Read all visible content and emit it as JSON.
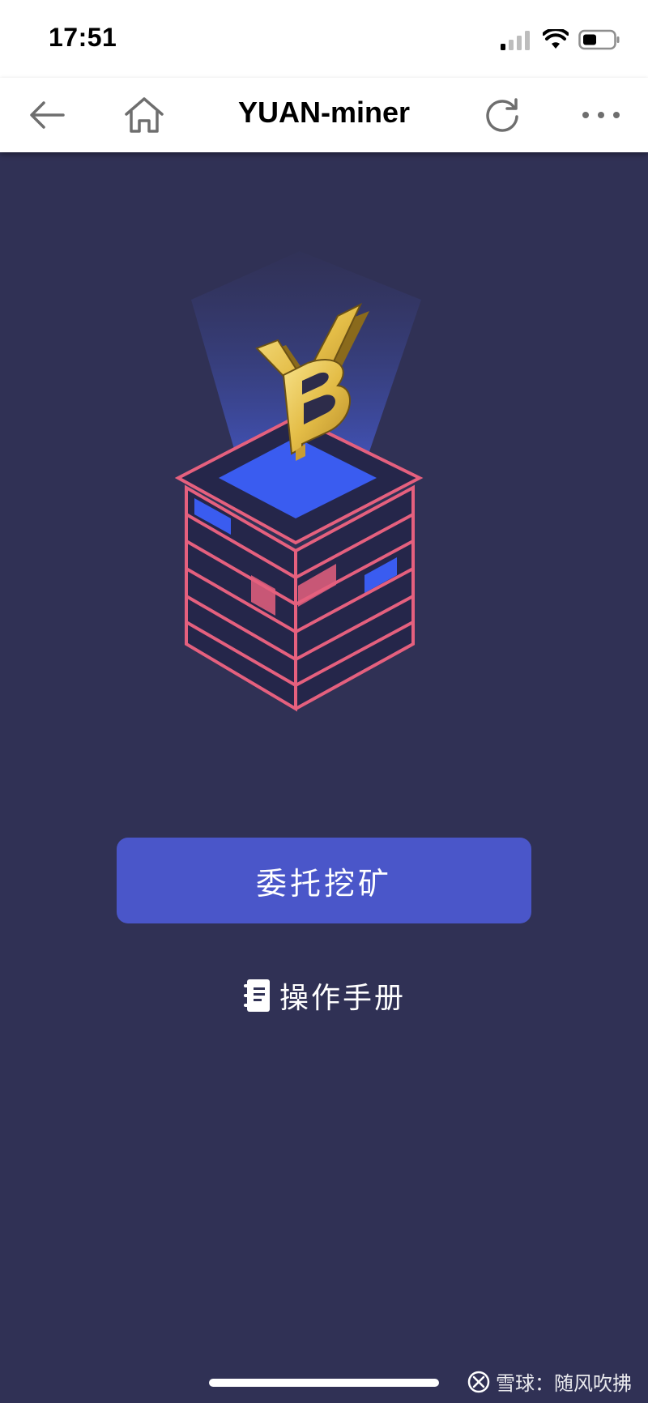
{
  "status_bar": {
    "time": "17:51"
  },
  "nav": {
    "title": "YUAN-miner",
    "icons": [
      "back-arrow-icon",
      "home-icon",
      "refresh-icon",
      "more-icon"
    ]
  },
  "hero": {
    "icon": "yuan-miner-illustration",
    "colors": {
      "box_outline": "#e5607e",
      "box_top": "#3a5cf0",
      "coin_gold": "#e8c14f",
      "beam": "#4a5cc8"
    }
  },
  "main": {
    "primary_button_label": "委托挖矿",
    "manual_label": "操作手册"
  },
  "footer": {
    "watermark_text": "雪球：随风吹拂"
  },
  "colors": {
    "background": "#303155",
    "accent": "#4a56c9"
  }
}
